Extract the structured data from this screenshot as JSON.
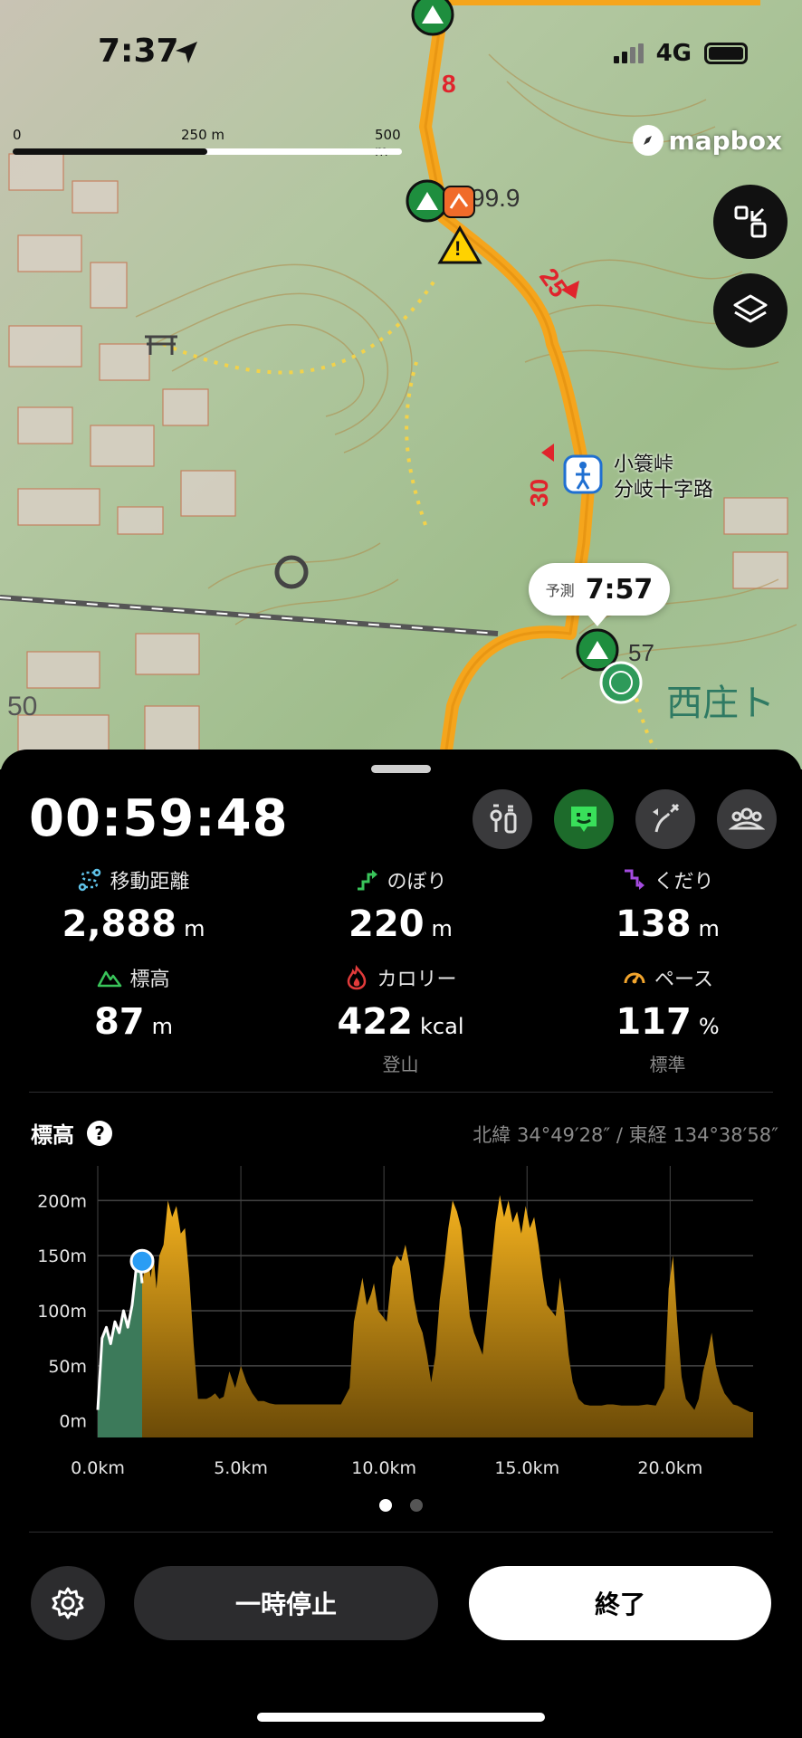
{
  "status_bar": {
    "time": "7:37",
    "network": "4G"
  },
  "map": {
    "scale": {
      "labels": [
        "0",
        "250 m",
        "500 m"
      ]
    },
    "attribution": "mapbox",
    "callout": {
      "label": "予測",
      "time": "7:57"
    },
    "place_label": [
      "小簑峠",
      "分岐十字路"
    ],
    "route_numbers": [
      "8",
      "25",
      "30"
    ],
    "peak_labels": [
      "99.9",
      "57"
    ],
    "area_labels": [
      "西庄ト",
      "50"
    ],
    "buttons": [
      "collapse-icon",
      "layers-icon"
    ],
    "colors": {
      "route": "#F5A51C",
      "peak": "#1E8E3E"
    }
  },
  "panel": {
    "timer": "00:59:48",
    "mode_buttons": [
      "map-pins-icon",
      "face-icon",
      "route-icon",
      "group-icon"
    ],
    "stats": [
      {
        "label": "移動距離",
        "value": "2,888",
        "unit": "m",
        "icon": "distance-icon",
        "color": "#5fc2e8"
      },
      {
        "label": "のぼり",
        "value": "220",
        "unit": "m",
        "icon": "ascent-icon",
        "color": "#39c45a"
      },
      {
        "label": "くだり",
        "value": "138",
        "unit": "m",
        "icon": "descent-icon",
        "color": "#a44be0"
      },
      {
        "label": "標高",
        "value": "87",
        "unit": "m",
        "icon": "mountain-icon",
        "color": "#39c45a"
      },
      {
        "label": "カロリー",
        "value": "422",
        "unit": "kcal",
        "icon": "flame-icon",
        "color": "#e23b3b",
        "sub": "登山"
      },
      {
        "label": "ペース",
        "value": "117",
        "unit": "%",
        "icon": "gauge-icon",
        "color": "#f2a52d",
        "sub": "標準"
      }
    ],
    "elevation": {
      "title": "標高",
      "coords": "北緯 34°49′28″ / 東経 134°38′58″"
    },
    "buttons": {
      "pause": "一時停止",
      "end": "終了"
    }
  },
  "chart_data": {
    "type": "area",
    "title": "標高",
    "xlabel": "",
    "ylabel": "",
    "x_ticks": [
      "0.0km",
      "5.0km",
      "10.0km",
      "15.0km",
      "20.0km"
    ],
    "y_ticks": [
      "0m",
      "50m",
      "100m",
      "150m",
      "200m"
    ],
    "xlim": [
      0,
      22.9
    ],
    "ylim": [
      -15,
      215
    ],
    "series": [
      {
        "x": [
          0,
          0.15,
          0.3,
          0.45,
          0.6,
          0.75,
          0.9,
          1.05,
          1.2,
          1.35,
          1.45,
          1.55,
          1.65,
          1.75,
          1.85,
          1.95,
          2.05,
          2.15,
          2.3,
          2.45,
          2.6,
          2.75,
          2.9,
          3.05,
          3.2,
          3.35,
          3.5,
          3.65,
          3.8,
          3.95,
          4.1,
          4.25,
          4.4,
          4.6,
          4.8,
          5.0,
          5.2,
          5.4,
          5.6,
          5.8,
          6.0,
          6.2,
          6.4,
          6.8,
          7.4,
          8.0,
          8.5,
          8.8,
          8.95,
          9.1,
          9.25,
          9.4,
          9.55,
          9.65,
          9.8,
          9.95,
          10.1,
          10.3,
          10.45,
          10.6,
          10.75,
          10.9,
          11.05,
          11.2,
          11.35,
          11.5,
          11.65,
          11.8,
          11.95,
          12.1,
          12.25,
          12.4,
          12.55,
          12.7,
          12.85,
          13.0,
          13.15,
          13.3,
          13.45,
          13.6,
          13.75,
          13.9,
          14.05,
          14.2,
          14.35,
          14.5,
          14.65,
          14.8,
          14.95,
          15.1,
          15.25,
          15.4,
          15.55,
          15.7,
          15.85,
          16.0,
          16.15,
          16.3,
          16.45,
          16.6,
          16.8,
          17.0,
          17.2,
          17.4,
          17.6,
          17.8,
          18.0,
          18.3,
          18.6,
          18.9,
          19.2,
          19.5,
          19.8,
          19.95,
          20.1,
          20.25,
          20.4,
          20.55,
          20.7,
          20.85,
          21.0,
          21.15,
          21.3,
          21.45,
          21.6,
          21.75,
          21.9,
          22.05,
          22.2,
          22.35,
          22.5,
          22.65,
          22.8,
          22.9
        ],
        "y": [
          10,
          75,
          85,
          70,
          90,
          80,
          100,
          85,
          105,
          140,
          150,
          125,
          140,
          150,
          130,
          150,
          120,
          150,
          160,
          200,
          185,
          195,
          170,
          175,
          130,
          70,
          20,
          20,
          20,
          22,
          25,
          20,
          22,
          45,
          30,
          50,
          35,
          25,
          18,
          18,
          16,
          15,
          15,
          15,
          15,
          15,
          15,
          30,
          90,
          110,
          130,
          105,
          115,
          125,
          100,
          95,
          90,
          140,
          150,
          145,
          160,
          140,
          110,
          90,
          80,
          60,
          35,
          60,
          110,
          140,
          175,
          200,
          190,
          175,
          135,
          95,
          80,
          70,
          60,
          100,
          140,
          180,
          205,
          185,
          200,
          180,
          190,
          170,
          195,
          175,
          185,
          160,
          130,
          105,
          100,
          95,
          130,
          100,
          60,
          35,
          20,
          15,
          14,
          14,
          14,
          15,
          15,
          14,
          14,
          14,
          15,
          14,
          30,
          120,
          150,
          90,
          40,
          20,
          15,
          10,
          20,
          45,
          60,
          80,
          50,
          35,
          25,
          20,
          15,
          14,
          12,
          10,
          8,
          8
        ]
      }
    ],
    "progress_x": 1.55,
    "marker_value": 145,
    "grid": true,
    "colors": {
      "fill": "#f5b21e",
      "done": "#3c7a5a",
      "line": "#ffffff",
      "marker": "#2a9df4",
      "grid": "#444"
    }
  }
}
